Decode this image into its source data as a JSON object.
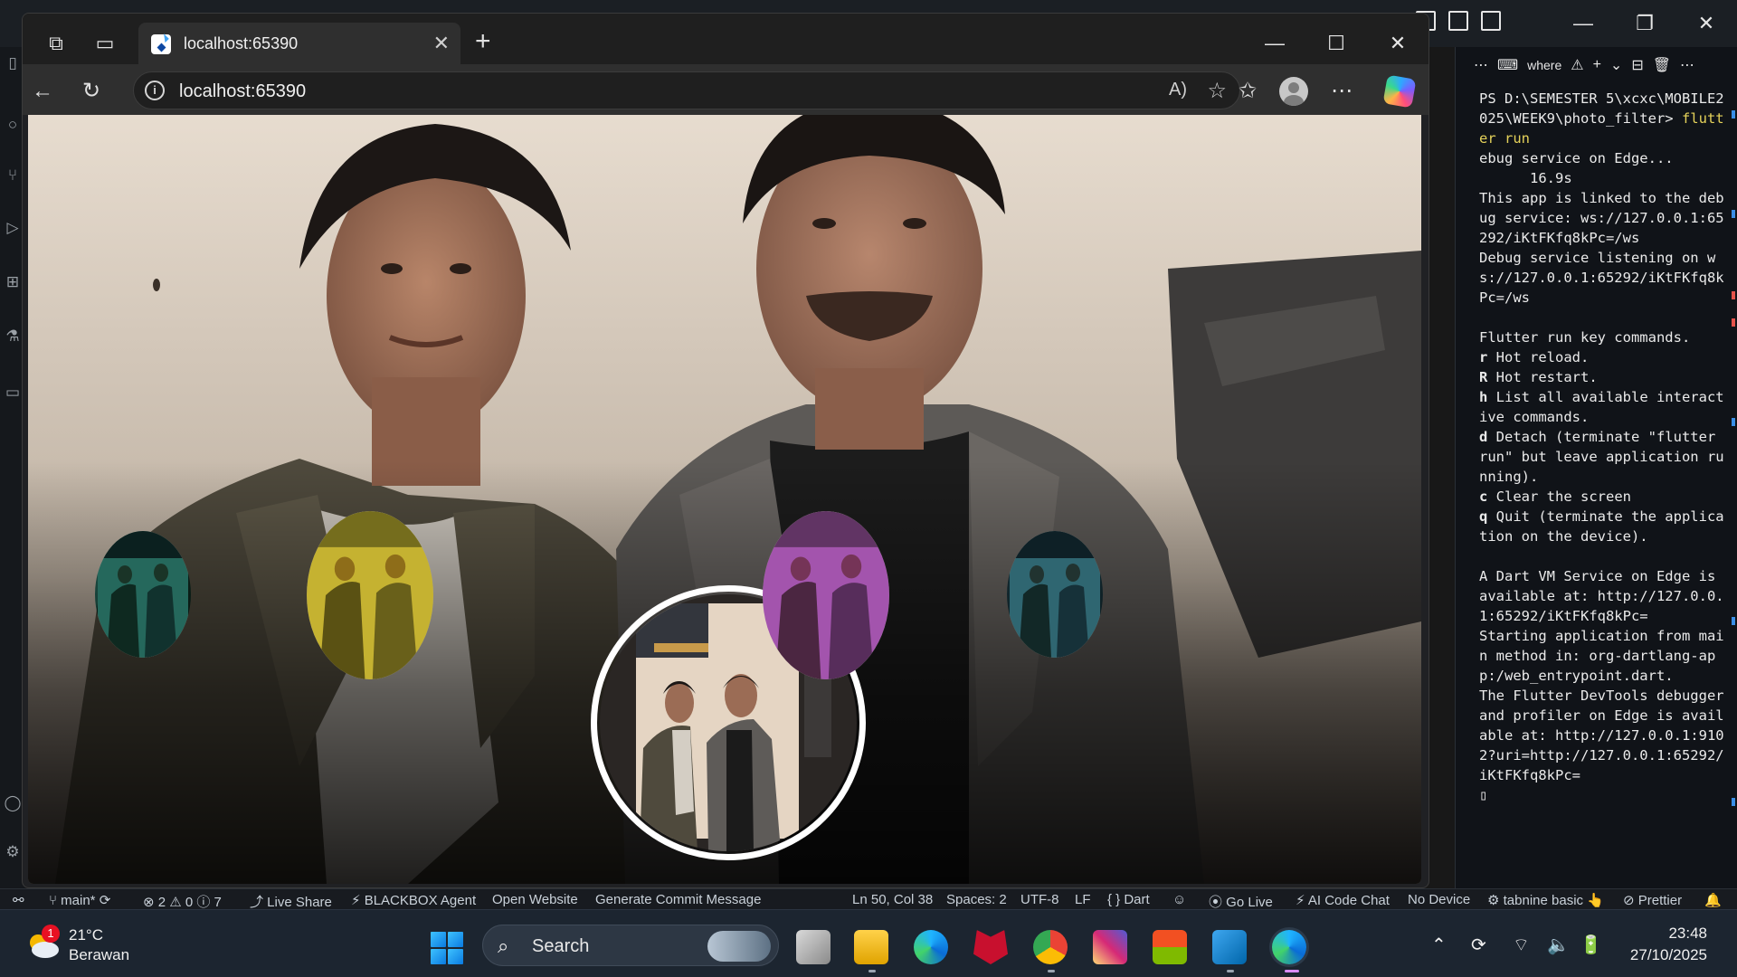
{
  "browser": {
    "tab_title": "localhost:65390",
    "address": "localhost:65390",
    "new_tab_symbol": "+",
    "close_symbol": "✕"
  },
  "app": {
    "filters": [
      {
        "name": "teal",
        "color": "#2f8d86"
      },
      {
        "name": "yellow",
        "color": "#d9c93b"
      },
      {
        "name": "none",
        "color": "#ffffff"
      },
      {
        "name": "purple",
        "color": "#b35fd0"
      },
      {
        "name": "blue-teal",
        "color": "#3c8aa6"
      }
    ],
    "selected_filter_index": 2
  },
  "terminal": {
    "toolbar_label": "where",
    "lines": [
      {
        "text": "PS D:\\SEMESTER 5\\xcxc\\MOBILE2025\\WEEK9\\photo_filter> ",
        "cmd": "flutter run"
      },
      {
        "text": "ebug service on Edge...\n      16.9s"
      },
      {
        "text": "This app is linked to the debug service: ws://127.0.0.1:65292/iKtFKfq8kPc=/ws"
      },
      {
        "text": "Debug service listening on ws://127.0.0.1:65292/iKtFKfq8kPc=/ws"
      },
      {
        "text": " "
      },
      {
        "text": "Flutter run key commands."
      },
      {
        "key": "r",
        "text": " Hot reload."
      },
      {
        "key": "R",
        "text": " Hot restart."
      },
      {
        "key": "h",
        "text": " List all available interactive commands."
      },
      {
        "key": "d",
        "text": " Detach (terminate \"flutter run\" but leave application running)."
      },
      {
        "key": "c",
        "text": " Clear the screen"
      },
      {
        "key": "q",
        "text": " Quit (terminate the application on the device)."
      },
      {
        "text": " "
      },
      {
        "text": "A Dart VM Service on Edge is available at: http://127.0.0.1:65292/iKtFKfq8kPc="
      },
      {
        "text": "Starting application from main method in: org-dartlang-app:/web_entrypoint.dart."
      },
      {
        "text": "The Flutter DevTools debugger and profiler on Edge is available at: http://127.0.0.1:9102?uri=http://127.0.0.1:65292/iKtFKfq8kPc="
      }
    ]
  },
  "statusbar": {
    "branch": "main*",
    "problems": "⊗ 2 ⚠ 0 ⓘ 7",
    "live_share": "Live Share",
    "blackbox": "BLACKBOX Agent",
    "open_website": "Open Website",
    "commit_msg": "Generate Commit Message",
    "cursor": "Ln 50, Col 38",
    "spaces": "Spaces: 2",
    "encoding": "UTF-8",
    "eol": "LF",
    "language": "{ } Dart",
    "go_live": "Go Live",
    "ai_chat": "AI Code Chat",
    "device": "No Device",
    "tabnine": "tabnine basic",
    "prettier": "Prettier"
  },
  "taskbar": {
    "weather_temp": "21°C",
    "weather_desc": "Berawan",
    "weather_badge": "1",
    "search_placeholder": "Search",
    "time": "23:48",
    "date": "27/10/2025"
  }
}
